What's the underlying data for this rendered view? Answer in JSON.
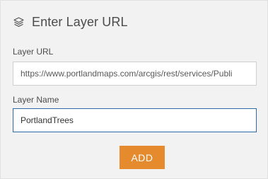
{
  "header": {
    "icon": "layers-icon",
    "title": "Enter Layer URL"
  },
  "form": {
    "url_label": "Layer URL",
    "url_value": "https://www.portlandmaps.com/arcgis/rest/services/Publi",
    "name_label": "Layer Name",
    "name_value": "PortlandTrees"
  },
  "actions": {
    "add_label": "ADD"
  },
  "colors": {
    "panel_bg": "#f2f2f2",
    "accent_button": "#e68a2e",
    "focus_border": "#2f6aa8",
    "text": "#4c4c4c"
  }
}
